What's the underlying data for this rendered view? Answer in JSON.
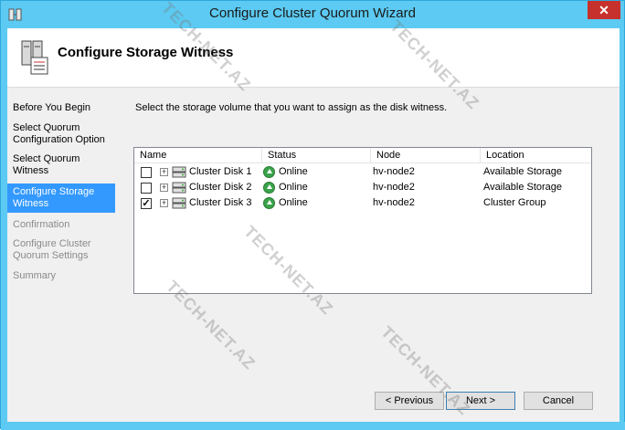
{
  "window": {
    "title": "Configure Cluster Quorum Wizard",
    "close_label": "✕"
  },
  "header": {
    "title": "Configure Storage Witness"
  },
  "nav": {
    "items": [
      {
        "label": "Before You Begin",
        "state": "normal"
      },
      {
        "label": "Select Quorum Configuration Option",
        "state": "normal"
      },
      {
        "label": "Select Quorum Witness",
        "state": "normal"
      },
      {
        "label": "Configure Storage Witness",
        "state": "selected"
      },
      {
        "label": "Confirmation",
        "state": "disabled"
      },
      {
        "label": "Configure Cluster Quorum Settings",
        "state": "disabled"
      },
      {
        "label": "Summary",
        "state": "disabled"
      }
    ]
  },
  "main": {
    "instruction": "Select the storage volume that you want to assign as the disk witness.",
    "columns": [
      "Name",
      "Status",
      "Node",
      "Location"
    ],
    "rows": [
      {
        "checked": false,
        "name": "Cluster Disk 1",
        "status": "Online",
        "node": "hv-node2",
        "location": "Available Storage"
      },
      {
        "checked": false,
        "name": "Cluster Disk 2",
        "status": "Online",
        "node": "hv-node2",
        "location": "Available Storage"
      },
      {
        "checked": true,
        "name": "Cluster Disk 3",
        "status": "Online",
        "node": "hv-node2",
        "location": "Cluster Group"
      }
    ],
    "check_mark": "✓",
    "expand_glyph": "+"
  },
  "buttons": {
    "previous": "< Previous",
    "next": "Next >",
    "cancel": "Cancel"
  },
  "watermarks": [
    "TECH-NET.AZ",
    "TECH-NET.AZ",
    "TECH-NET.AZ",
    "TECH-NET.AZ",
    "TECH-NET.AZ"
  ],
  "colors": {
    "title_bar": "#5ccaf2",
    "selection": "#3399ff",
    "close_button": "#c7312d",
    "online_status": "#3aa34a"
  }
}
